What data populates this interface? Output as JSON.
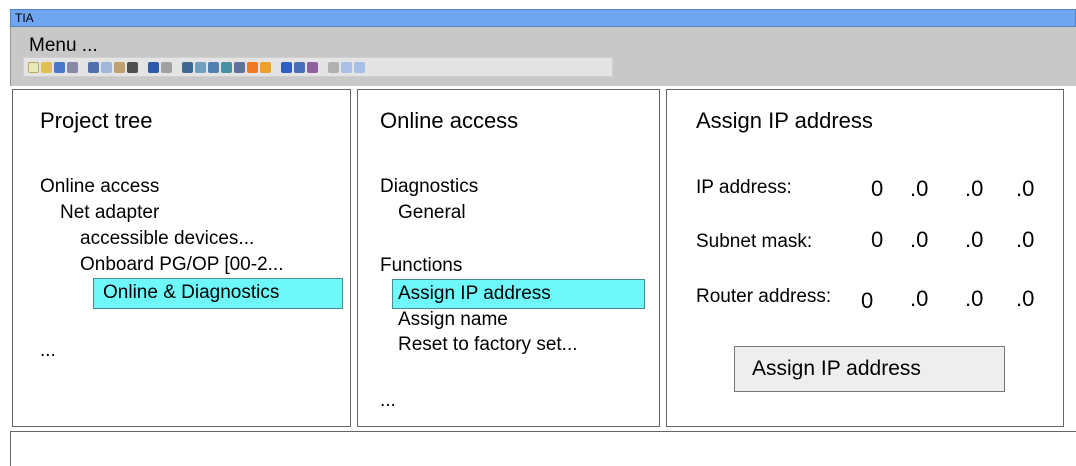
{
  "window": {
    "title": "TIA"
  },
  "menubar": {
    "label": "Menu ..."
  },
  "toolbar": {
    "icons": [
      "new-project-icon",
      "open-project-icon",
      "save-project-icon",
      "print-icon",
      "cut-icon",
      "copy-icon",
      "paste-icon",
      "delete-icon",
      "undo-icon",
      "redo-icon",
      "compile-icon",
      "download-icon",
      "upload-icon",
      "go-online-icon",
      "go-offline-icon",
      "start-cpu-icon",
      "stop-cpu-icon",
      "accessible-devices-icon",
      "cross-reference-icon",
      "close-icon",
      "split-horizontal-icon",
      "split-vertical-icon"
    ]
  },
  "project_tree": {
    "title": "Project tree",
    "items": [
      "Online access",
      "Net adapter",
      "accessible devices...",
      "Onboard PG/OP [00-2...",
      "Online & Diagnostics",
      "..."
    ]
  },
  "online_access": {
    "title": "Online access",
    "diagnostics": "Diagnostics",
    "general": "General",
    "functions": "Functions",
    "assign_ip": "Assign IP address",
    "assign_name": "Assign name",
    "reset": "Reset to factory set...",
    "more": "..."
  },
  "assign_ip": {
    "title": "Assign IP address",
    "ip_label": "IP address:",
    "subnet_label": "Subnet mask:",
    "router_label": "Router address:",
    "ip_octets": [
      "0",
      ".0",
      ".0",
      ".0"
    ],
    "subnet_octets": [
      "0",
      ".0",
      ".0",
      ".0"
    ],
    "router_octets": [
      "0",
      ".0",
      ".0",
      ".0"
    ],
    "button": "Assign IP address"
  },
  "colors": {
    "titlebar": "#6fa6ef",
    "selection": "#6ff8f9",
    "menubar": "#c8c8c8"
  }
}
